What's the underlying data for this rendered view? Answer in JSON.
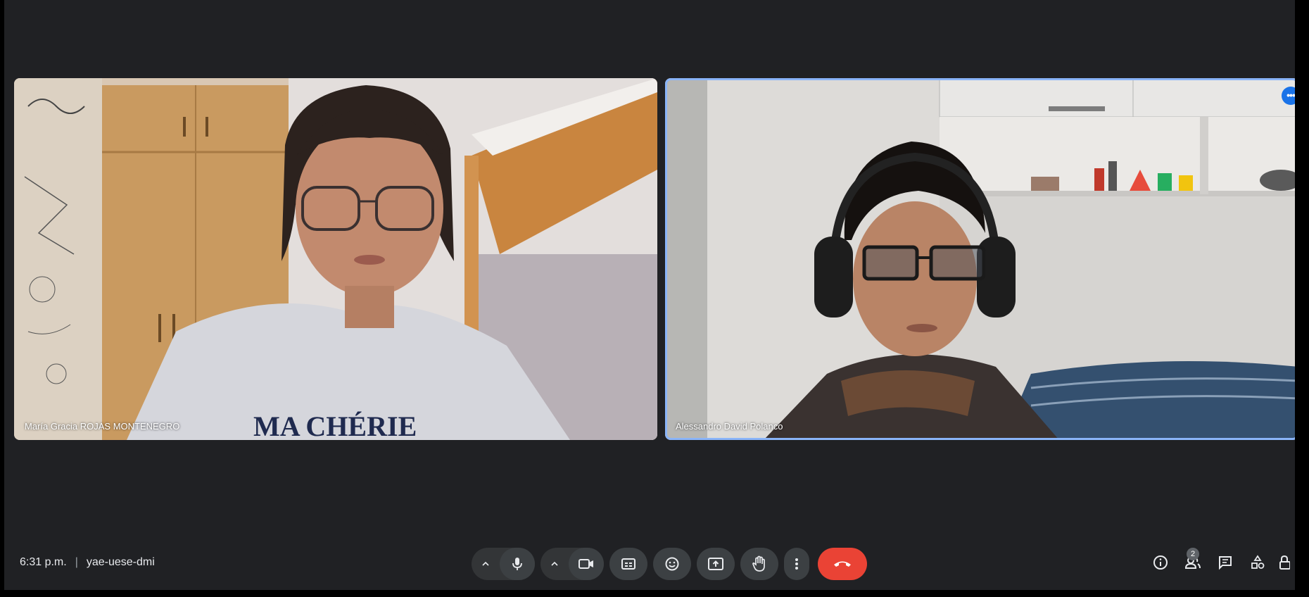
{
  "participants": [
    {
      "name": "María Gracia ROJAS MONTENEGRO",
      "active_speaker": false
    },
    {
      "name": "Alessandro David Polanco",
      "active_speaker": true
    }
  ],
  "meeting": {
    "time": "6:31 p.m.",
    "separator": "|",
    "code": "yae-uese-dmi"
  },
  "controls": {
    "more_tile_options_icon": "more-horizontal-icon",
    "mic_icon": "microphone-icon",
    "camera_icon": "video-camera-icon",
    "captions_icon": "closed-captions-icon",
    "emoji_icon": "emoji-icon",
    "present_icon": "present-screen-icon",
    "raise_hand_icon": "raise-hand-icon",
    "more_icon": "more-vertical-icon",
    "end_call_icon": "end-call-icon"
  },
  "side_panel": {
    "people_count": "2",
    "icons": [
      "info-icon",
      "people-icon",
      "chat-icon",
      "activities-icon",
      "lock-icon"
    ]
  },
  "colors": {
    "background": "#202124",
    "active_border": "#8ab4f8",
    "end_call": "#ea4335",
    "button_bg": "#3c4043"
  }
}
